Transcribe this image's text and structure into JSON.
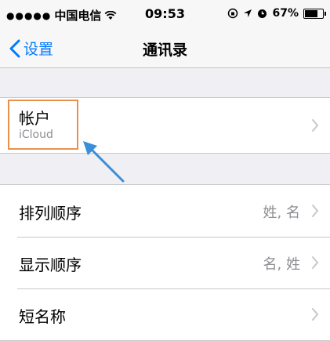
{
  "status_bar": {
    "carrier": "中国电信",
    "time": "09:53",
    "battery": "67%"
  },
  "nav": {
    "back_label": "设置",
    "title": "通讯录"
  },
  "account": {
    "title": "帐户",
    "subtitle": "iCloud"
  },
  "settings": [
    {
      "label": "排列顺序",
      "value": "姓, 名"
    },
    {
      "label": "显示顺序",
      "value": "名, 姓"
    },
    {
      "label": "短名称",
      "value": ""
    }
  ],
  "colors": {
    "accent": "#007aff",
    "highlight": "#e8914f",
    "arrow": "#3a8fd8"
  }
}
